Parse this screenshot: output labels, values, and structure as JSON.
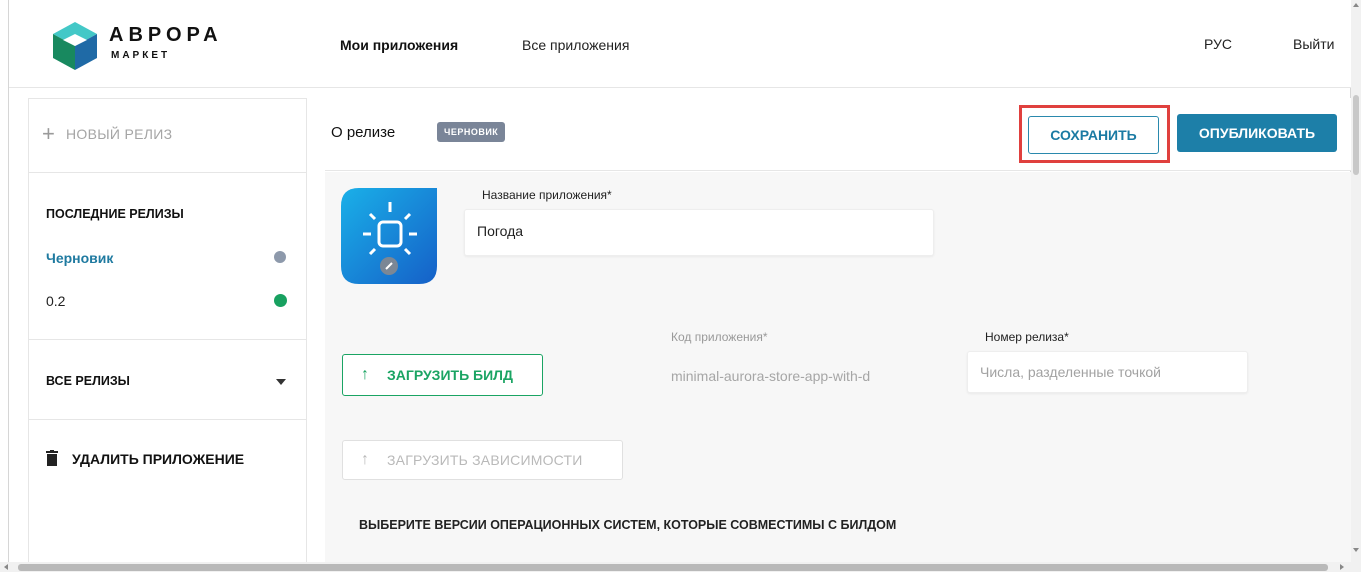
{
  "brand": {
    "title": "АВРОРА",
    "subtitle": "МАРКЕТ"
  },
  "header": {
    "nav": {
      "mine": "Мои приложения",
      "all": "Все приложения"
    },
    "lang": "РУС",
    "logout": "Выйти"
  },
  "sidebar": {
    "new_release": "НОВЫЙ РЕЛИЗ",
    "recent_title": "ПОСЛЕДНИЕ РЕЛИЗЫ",
    "releases": [
      {
        "label": "Черновик",
        "status_color": "#8d99ab"
      },
      {
        "label": "0.2",
        "status_color": "#18a160"
      }
    ],
    "all_releases": "ВСЕ РЕЛИЗЫ",
    "delete_app": "УДАЛИТЬ ПРИЛОЖЕНИЕ"
  },
  "main": {
    "title": "О релизе",
    "badge": "ЧЕРНОВИК",
    "save": "СОХРАНИТЬ",
    "publish": "ОПУБЛИКОВАТЬ",
    "app_name_label": "Название приложения*",
    "app_name_value": "Погода",
    "upload_build": "ЗАГРУЗИТЬ БИЛД",
    "app_code_label": "Код приложения*",
    "app_code_value": "minimal-aurora-store-app-with-d",
    "release_number_label": "Номер релиза*",
    "release_number_placeholder": "Числа, разделенные точкой",
    "upload_deps": "ЗАГРУЗИТЬ ЗАВИСИМОСТИ",
    "os_title": "ВЫБЕРИТЕ ВЕРСИИ ОПЕРАЦИОННЫХ СИСТЕМ, КОТОРЫЕ СОВМЕСТИМЫ С БИЛДОМ"
  },
  "icons": {
    "logo": "aurora-cube-logo",
    "add": "plus-icon",
    "dropdown": "caret-down-icon",
    "delete": "trash-icon",
    "upload": "arrow-up-icon",
    "app": "weather-app-icon",
    "edit": "pencil-icon"
  },
  "colors": {
    "accent": "#1d7fa8",
    "success": "#18a160",
    "badge": "#7a8598",
    "highlight": "#e0403e"
  }
}
